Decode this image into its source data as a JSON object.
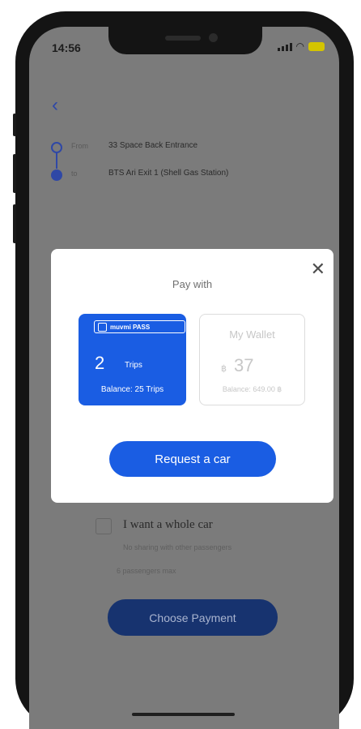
{
  "status_bar": {
    "time": "14:56"
  },
  "route": {
    "from_label": "From",
    "from_value": "33 Space Back Entrance",
    "to_label": "to",
    "to_value": "BTS Ari Exit 1 (Shell Gas Station)"
  },
  "modal": {
    "title": "Pay with",
    "pass_card": {
      "brand": "muvmi PASS",
      "trips_count": "2",
      "trips_unit": "Trips",
      "balance": "Balance: 25 Trips"
    },
    "wallet_card": {
      "title": "My Wallet",
      "currency": "฿",
      "amount": "37",
      "balance": "Balance: 649.00 ฿"
    },
    "request_button": "Request a car"
  },
  "whole_car": {
    "label": "I want a whole car",
    "note1": "No sharing with other passengers",
    "note2": "6 passengers max"
  },
  "choose_payment_button": "Choose Payment",
  "colors": {
    "accent": "#1a5de3",
    "overlay": "#7b7b7b",
    "dark_button": "#17336f"
  }
}
